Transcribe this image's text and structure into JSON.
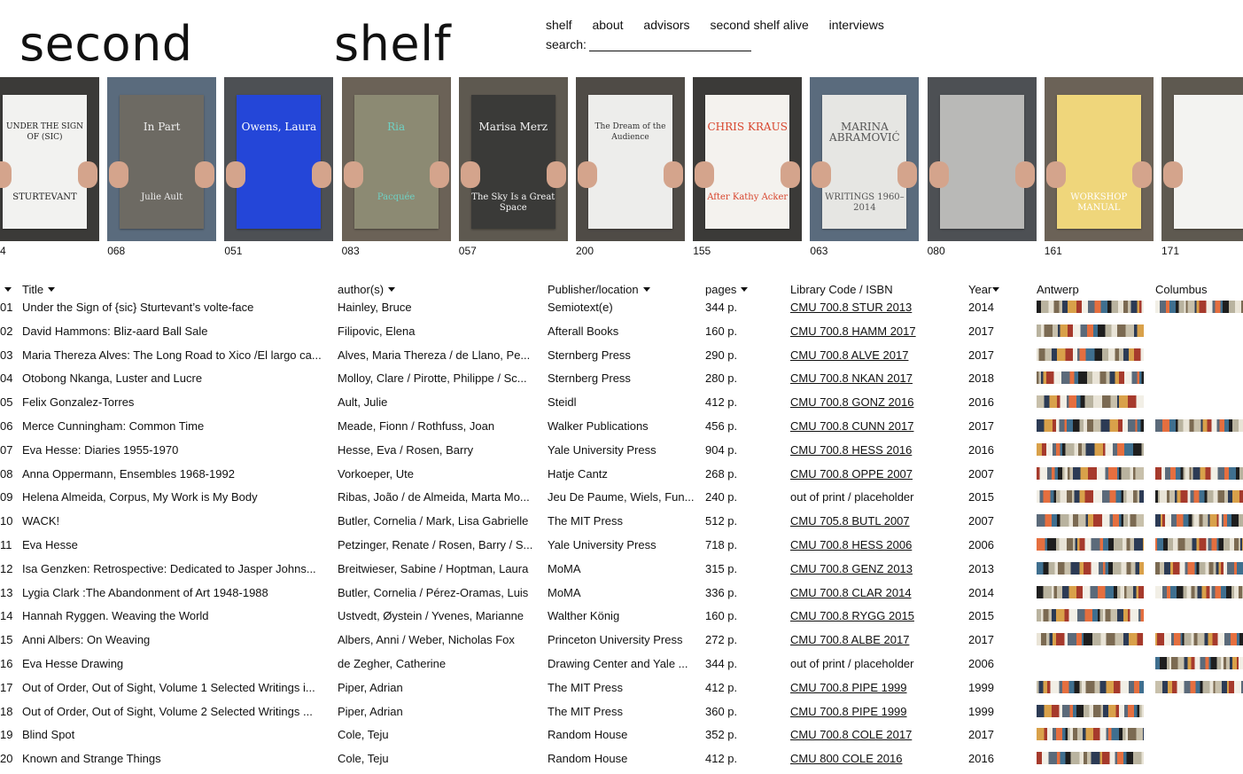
{
  "header": {
    "logo_left": "second",
    "logo_right": "shelf",
    "nav": [
      "shelf",
      "about",
      "advisors",
      "second shelf alive",
      "interviews"
    ],
    "search_label": "search:",
    "search_value": ""
  },
  "carousel": [
    {
      "num": "4",
      "title": "UNDER THE SIGN OF (SIC)",
      "subtitle": "STURTEVANT",
      "cover": "#f2f2f0",
      "text": "#222"
    },
    {
      "num": "068",
      "title": "In Part",
      "subtitle": "Julie Ault",
      "cover": "#6d6a63",
      "text": "#eee"
    },
    {
      "num": "051",
      "title": "Owens, Laura",
      "subtitle": "",
      "cover": "#2446d8",
      "text": "#fff"
    },
    {
      "num": "083",
      "title": "Ria",
      "subtitle": "Pacquée",
      "cover": "#8c8a73",
      "text": "#6fd0c3"
    },
    {
      "num": "057",
      "title": "Marisa Merz",
      "subtitle": "The Sky Is a Great Space",
      "cover": "#3a3a38",
      "text": "#f4f4f4"
    },
    {
      "num": "200",
      "title": "The Dream of the Audience",
      "subtitle": "",
      "cover": "#ededeb",
      "text": "#333"
    },
    {
      "num": "155",
      "title": "CHRIS KRAUS",
      "subtitle": "After Kathy Acker",
      "cover": "#f4f2ee",
      "text": "#d8452d"
    },
    {
      "num": "063",
      "title": "MARINA ABRAMOVIĆ",
      "subtitle": "WRITINGS 1960–2014",
      "cover": "#e6e6e3",
      "text": "#555"
    },
    {
      "num": "080",
      "title": "",
      "subtitle": "",
      "cover": "#b9b9b7",
      "text": "#333"
    },
    {
      "num": "161",
      "title": "",
      "subtitle": "WORKSHOP MANUAL",
      "cover": "#efd67b",
      "text": "#fff"
    },
    {
      "num": "171",
      "title": "",
      "subtitle": "",
      "cover": "#f3f3f1",
      "text": "#333"
    }
  ],
  "table": {
    "headers": {
      "no": "",
      "title": "Title",
      "author": "author(s)",
      "publisher": "Publisher/location",
      "pages": "pages",
      "library": "Library Code / ISBN",
      "year": "Year",
      "antwerp": "Antwerp",
      "columbus": "Columbus"
    },
    "rows": [
      {
        "no": "01",
        "title": "Under the Sign of {sic} Sturtevant’s volte-face",
        "author": "Hainley, Bruce",
        "publisher": "Semiotext(e)",
        "pages": "344 p.",
        "library": "CMU 700.8 STUR 2013",
        "year": "2014",
        "ant": true,
        "col": true
      },
      {
        "no": "02",
        "title": "David Hammons: Bliz-aard Ball Sale",
        "author": "Filipovic, Elena",
        "publisher": "Afterall Books",
        "pages": "160 p.",
        "library": "CMU 700.8 HAMM 2017",
        "year": "2017",
        "ant": true,
        "col": false
      },
      {
        "no": "03",
        "title": "Maria Thereza Alves: The Long Road to Xico /El largo ca...",
        "author": "Alves, Maria Thereza / de Llano, Pe...",
        "publisher": "Sternberg Press",
        "pages": "290 p.",
        "library": "CMU 700.8 ALVE 2017",
        "year": "2017",
        "ant": true,
        "col": false
      },
      {
        "no": "04",
        "title": "Otobong Nkanga, Luster and Lucre",
        "author": "Molloy, Clare / Pirotte, Philippe / Sc...",
        "publisher": "Sternberg Press",
        "pages": "280 p.",
        "library": "CMU 700.8 NKAN 2017",
        "year": "2018",
        "ant": true,
        "col": false
      },
      {
        "no": "05",
        "title": "Felix Gonzalez-Torres",
        "author": "Ault, Julie",
        "publisher": "Steidl",
        "pages": "412 p.",
        "library": "CMU 700.8 GONZ 2016",
        "year": "2016",
        "ant": true,
        "col": false
      },
      {
        "no": "06",
        "title": "Merce Cunningham: Common Time",
        "author": "Meade, Fionn / Rothfuss, Joan",
        "publisher": "Walker Publications",
        "pages": "456 p.",
        "library": "CMU 700.8 CUNN 2017",
        "year": "2017",
        "ant": true,
        "col": true
      },
      {
        "no": "07",
        "title": "Eva Hesse: Diaries 1955-1970",
        "author": "Hesse, Eva / Rosen, Barry",
        "publisher": "Yale University Press",
        "pages": "904 p.",
        "library": "CMU 700.8 HESS 2016",
        "year": "2016",
        "ant": true,
        "col": false
      },
      {
        "no": "08",
        "title": "Anna Oppermann, Ensembles 1968-1992",
        "author": "Vorkoeper, Ute",
        "publisher": "Hatje Cantz",
        "pages": "268 p.",
        "library": "CMU 700.8 OPPE 2007",
        "year": "2007",
        "ant": true,
        "col": true
      },
      {
        "no": "09",
        "title": "Helena Almeida, Corpus, My Work is My Body",
        "author": "Ribas, João / de Almeida, Marta Mo...",
        "publisher": "Jeu De Paume, Wiels, Fun...",
        "pages": "240 p.",
        "library": "out of print / placeholder",
        "year": "2015",
        "ant": true,
        "col": true
      },
      {
        "no": "10",
        "title": "WACK!",
        "author": "Butler, Cornelia / Mark, Lisa Gabrielle",
        "publisher": "The MIT Press",
        "pages": "512 p.",
        "library": "CMU 705.8 BUTL 2007",
        "year": "2007",
        "ant": true,
        "col": true
      },
      {
        "no": "11",
        "title": "Eva Hesse",
        "author": "Petzinger, Renate / Rosen, Barry / S...",
        "publisher": "Yale University Press",
        "pages": "718 p.",
        "library": "CMU 700.8 HESS 2006",
        "year": "2006",
        "ant": true,
        "col": true
      },
      {
        "no": "12",
        "title": "Isa Genzken: Retrospective: Dedicated to Jasper Johns...",
        "author": "Breitwieser, Sabine / Hoptman, Laura",
        "publisher": "MoMA",
        "pages": "315 p.",
        "library": "CMU 700.8 GENZ 2013",
        "year": "2013",
        "ant": true,
        "col": true
      },
      {
        "no": "13",
        "title": "Lygia Clark :The Abandonment of Art 1948-1988",
        "author": "Butler, Cornelia / Pérez-Oramas, Luis",
        "publisher": "MoMA",
        "pages": "336 p.",
        "library": "CMU 700.8 CLAR 2014",
        "year": "2014",
        "ant": true,
        "col": true
      },
      {
        "no": "14",
        "title": "Hannah Ryggen. Weaving the World",
        "author": "Ustvedt, Øystein / Yvenes, Marianne",
        "publisher": "Walther König",
        "pages": "160 p.",
        "library": "CMU 700.8 RYGG 2015",
        "year": "2015",
        "ant": true,
        "col": false
      },
      {
        "no": "15",
        "title": "Anni Albers: On Weaving",
        "author": "Albers, Anni / Weber, Nicholas Fox",
        "publisher": "Princeton University Press",
        "pages": "272 p.",
        "library": "CMU 700.8 ALBE 2017",
        "year": "2017",
        "ant": true,
        "col": true
      },
      {
        "no": "16",
        "title": "Eva Hesse Drawing",
        "author": "de Zegher, Catherine",
        "publisher": "Drawing Center and Yale ...",
        "pages": "344 p.",
        "library": "out of print / placeholder",
        "year": "2006",
        "ant": false,
        "col": true
      },
      {
        "no": "17",
        "title": "Out of Order, Out of Sight, Volume 1 Selected Writings i...",
        "author": "Piper, Adrian",
        "publisher": "The MIT Press",
        "pages": "412 p.",
        "library": "CMU 700.8 PIPE 1999",
        "year": "1999",
        "ant": true,
        "col": true
      },
      {
        "no": "18",
        "title": "Out of Order, Out of Sight, Volume 2 Selected Writings ...",
        "author": "Piper, Adrian",
        "publisher": "The MIT Press",
        "pages": "360 p.",
        "library": "CMU 700.8 PIPE 1999",
        "year": "1999",
        "ant": true,
        "col": false
      },
      {
        "no": "19",
        "title": "Blind Spot",
        "author": "Cole, Teju",
        "publisher": "Random House",
        "pages": "352 p.",
        "library": "CMU 700.8 COLE 2017",
        "year": "2017",
        "ant": true,
        "col": false
      },
      {
        "no": "20",
        "title": "Known and Strange Things",
        "author": "Cole, Teju",
        "publisher": "Random House",
        "pages": "412 p.",
        "library": "CMU 800 COLE 2016",
        "year": "2016",
        "ant": true,
        "col": false
      }
    ]
  },
  "colors": {
    "background": "#ffffff",
    "text": "#111111",
    "shelf_palette": [
      "#1e1e1e",
      "#b9b39f",
      "#e9e4d7",
      "#7b6a52",
      "#c8c0ab",
      "#2c3b55",
      "#d9a14a",
      "#a63a2c",
      "#f2efe6",
      "#5b6a7a",
      "#e56f3f",
      "#3f6f8f"
    ]
  }
}
